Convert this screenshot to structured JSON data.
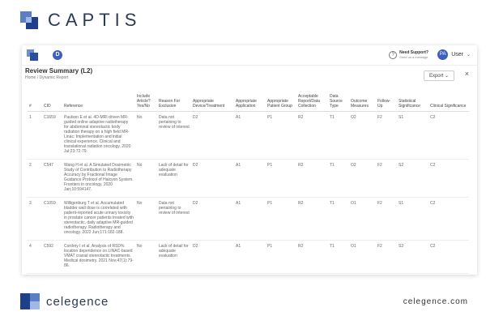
{
  "brand_top": {
    "name": "CAPTIS"
  },
  "topbar": {
    "nav_badge": "D",
    "support_title": "Need Support?",
    "support_sub": "Send us a message",
    "avatar_initials": "PA",
    "user_label": "User"
  },
  "header": {
    "title": "Review Summary (L2)",
    "breadcrumb": "Home / Dynamic Report",
    "export_label": "Export",
    "close_glyph": "×"
  },
  "table": {
    "columns": [
      "#",
      "CID",
      "Reference",
      "Include Article? Yes/No",
      "Reason For Exclusion",
      "Appropriate Device/Treatment",
      "Appropriate Application",
      "Appropriate Patient Group",
      "Acceptable Report/Data Collection",
      "Data Source Type",
      "Outcome Measures",
      "Follow-Up",
      "Statistical Significance",
      "Clinical Significance"
    ],
    "rows": [
      [
        "1",
        "C1659",
        "Paulson E et al. 4D-MRI driven MR-guided online adaptive radiotherapy for abdominal stereotactic body radiation therapy on a high field MR-Linac: Implementation and initial clinical experience. Clinical and translational radiation oncology. 2020 Jul;23:72-79.",
        "No",
        "Data not pertaining to review of interest",
        "D2",
        "A1",
        "P1",
        "R2",
        "T1",
        "O2",
        "F2",
        "S1",
        "C2"
      ],
      [
        "2",
        "C547",
        "Wang H et al. A Simulated Dosimetric Study of Contribution to Radiotherapy Accuracy by Fractional Image Guidance Protocol of Halcyon System. Frontiers in oncology. 2020 Jan;10:594147.",
        "No",
        "Lack of detail for adequate evaluation",
        "D2",
        "A1",
        "P1",
        "R2",
        "T1",
        "O2",
        "F2",
        "S2",
        "C2"
      ],
      [
        "3",
        "C1059",
        "Willigenburg T et al. Accumulated bladder wall dose is correlated with patient-reported acute urinary toxicity in prostate cancer patients treated with stereotactic, daily adaptive MR-guided radiotherapy. Radiotherapy and oncology. 2022 Jun;171:182-188.",
        "No",
        "Data not pertaining to review of interest",
        "D2",
        "A1",
        "P1",
        "R2",
        "T1",
        "O1",
        "F2",
        "S1",
        "C2"
      ],
      [
        "4",
        "C592",
        "Cordrey I et al. Analysis of RSD% location dependence on LINAC-based VMAT cranial stereotactic treatments. Medical dosimetry. 2021 Nov;47(1):79-86.",
        "No",
        "Lack of detail for adequate evaluation",
        "D2",
        "A1",
        "P1",
        "R2",
        "T1",
        "O1",
        "F2",
        "S2",
        "C2"
      ]
    ]
  },
  "brand_bottom": {
    "name": "celegence",
    "website": "celegence.com"
  }
}
